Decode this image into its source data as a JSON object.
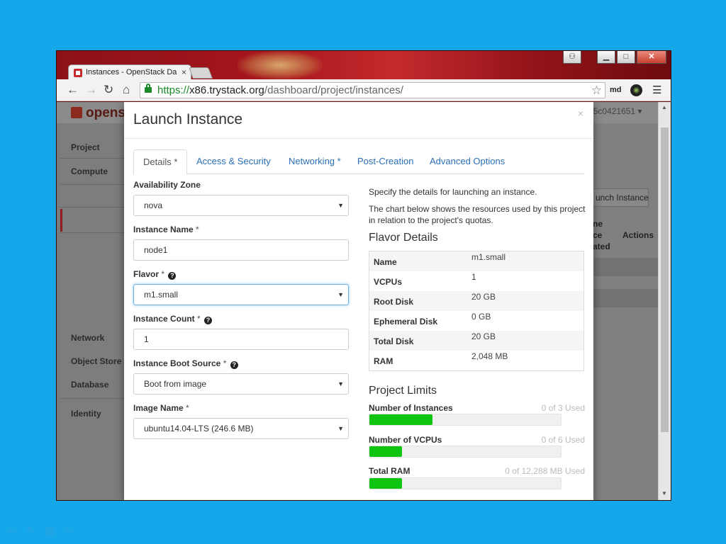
{
  "browser": {
    "tab_title": "Instances - OpenStack Da",
    "tab_close": "×",
    "url_scheme": "https://",
    "url_host": "x86.trystack.org",
    "url_path": "/dashboard/project/instances/",
    "profile": "md",
    "window_controls": {
      "minimize": "▁",
      "maximize": "□",
      "close": "✕",
      "user": "⚇"
    }
  },
  "background_page": {
    "logo": "openst",
    "user_text": "85c0421651 ▾",
    "sidebar": [
      {
        "label": "Project"
      },
      {
        "label": "Compute"
      },
      {
        "label": "Network"
      },
      {
        "label": "Object Store"
      },
      {
        "label": "Database"
      },
      {
        "label": "Identity"
      }
    ],
    "launch_button": "unch Instance",
    "table_headers": {
      "col_a": "ne\nce\nated",
      "col_b": "Actions"
    }
  },
  "modal": {
    "title": "Launch Instance",
    "close": "×",
    "tabs": [
      {
        "label": "Details *",
        "active": true
      },
      {
        "label": "Access & Security",
        "active": false
      },
      {
        "label": "Networking *",
        "active": false
      },
      {
        "label": "Post-Creation",
        "active": false
      },
      {
        "label": "Advanced Options",
        "active": false
      }
    ],
    "form": {
      "availability_zone": {
        "label": "Availability Zone",
        "value": "nova"
      },
      "instance_name": {
        "label": "Instance Name",
        "required": "*",
        "value": "node1"
      },
      "flavor": {
        "label": "Flavor",
        "required": "*",
        "value": "m1.small"
      },
      "instance_count": {
        "label": "Instance Count",
        "required": "*",
        "value": "1"
      },
      "boot_source": {
        "label": "Instance Boot Source",
        "required": "*",
        "value": "Boot from image"
      },
      "image_name": {
        "label": "Image Name",
        "required": "*",
        "value": "ubuntu14.04-LTS (246.6 MB)"
      }
    },
    "info": {
      "line1": "Specify the details for launching an instance.",
      "line2": "The chart below shows the resources used by this project in relation to the project's quotas.",
      "flavor_heading": "Flavor Details",
      "flavor_rows": [
        {
          "name": "Name",
          "value": "m1.small"
        },
        {
          "name": "VCPUs",
          "value": "1"
        },
        {
          "name": "Root Disk",
          "value": "20 GB"
        },
        {
          "name": "Ephemeral Disk",
          "value": "0 GB"
        },
        {
          "name": "Total Disk",
          "value": "20 GB"
        },
        {
          "name": "RAM",
          "value": "2,048 MB"
        }
      ],
      "limits_heading": "Project Limits",
      "limits": [
        {
          "label": "Number of Instances",
          "used_text": "0 of 3 Used",
          "fill": 0.33
        },
        {
          "label": "Number of VCPUs",
          "used_text": "0 of 6 Used",
          "fill": 0.17
        },
        {
          "label": "Total RAM",
          "used_text": "0 of 12,288 MB Used",
          "fill": 0.17
        }
      ]
    }
  },
  "colors": {
    "bar_fill": "#0fc40f",
    "link": "#2a6fb5",
    "desktop": "#14a8ea"
  }
}
